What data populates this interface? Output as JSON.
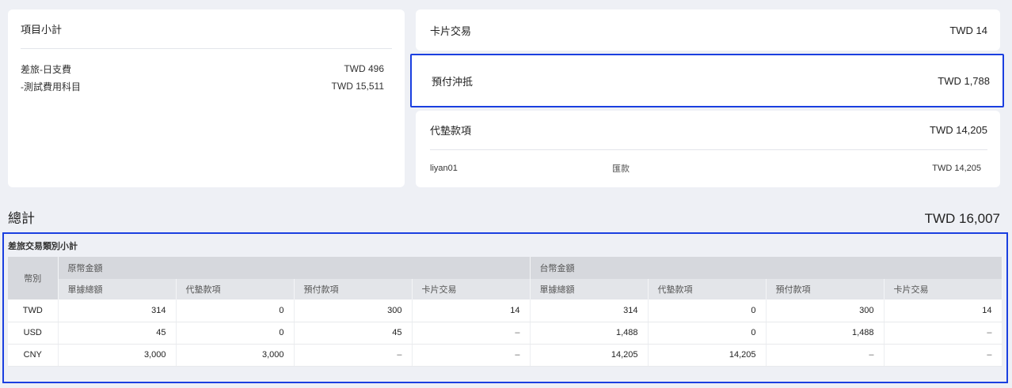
{
  "left_card": {
    "title": "項目小計",
    "items": [
      {
        "label": "差旅-日支費",
        "amount": "TWD 496"
      },
      {
        "label": "-測試費用科目",
        "amount": "TWD 15,511"
      }
    ]
  },
  "card_transaction": {
    "label": "卡片交易",
    "amount": "TWD 14"
  },
  "prepay_offset": {
    "label": "預付沖抵",
    "amount": "TWD 1,788"
  },
  "advance": {
    "label": "代墊款項",
    "amount": "TWD 14,205",
    "detail": {
      "who": "liyan01",
      "method": "匯款",
      "amount": "TWD 14,205"
    }
  },
  "total": {
    "label": "總計",
    "amount": "TWD 16,007"
  },
  "table": {
    "title": "差旅交易類別小計",
    "currency_header": "幣別",
    "group_original": "原幣金額",
    "group_twd": "台幣金額",
    "sub_headers": [
      "單據總額",
      "代墊款項",
      "預付款項",
      "卡片交易",
      "單據總額",
      "代墊款項",
      "預付款項",
      "卡片交易"
    ],
    "rows": [
      {
        "currency": "TWD",
        "cells": [
          "314",
          "0",
          "300",
          "14",
          "314",
          "0",
          "300",
          "14"
        ]
      },
      {
        "currency": "USD",
        "cells": [
          "45",
          "0",
          "45",
          "–",
          "1,488",
          "0",
          "1,488",
          "–"
        ]
      },
      {
        "currency": "CNY",
        "cells": [
          "3,000",
          "3,000",
          "–",
          "–",
          "14,205",
          "14,205",
          "–",
          "–"
        ]
      }
    ]
  }
}
